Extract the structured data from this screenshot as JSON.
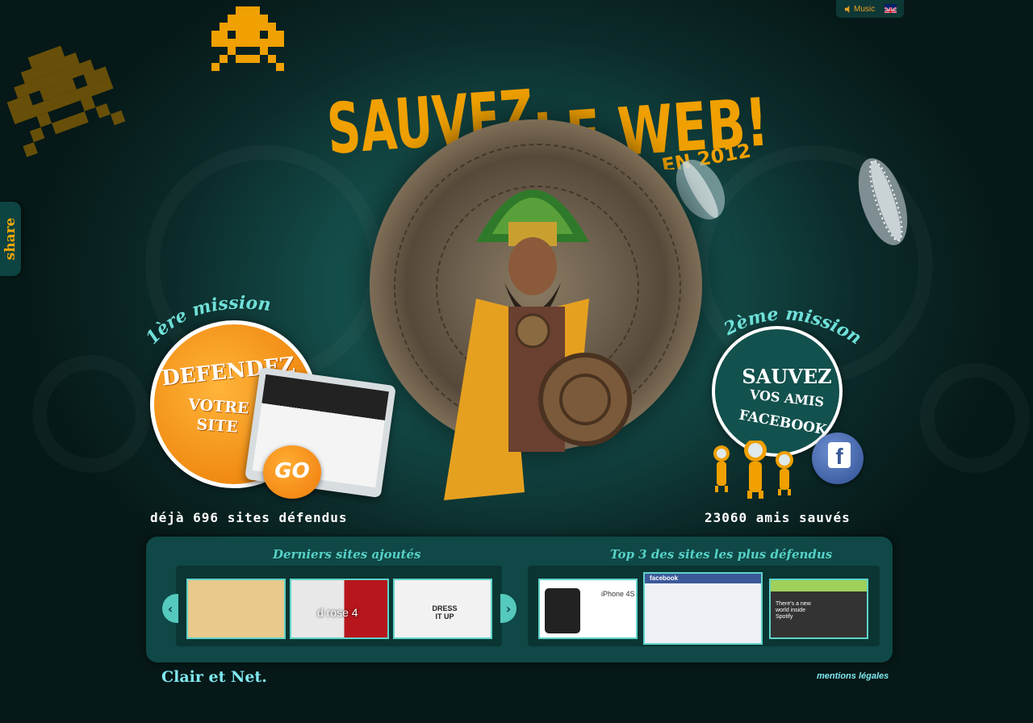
{
  "topbar": {
    "music_label": "Music",
    "language_flag": "uk-flag-icon"
  },
  "share": {
    "label": "share"
  },
  "header": {
    "title_line1": "SAUVEZ",
    "title_line2": "LE WEB!",
    "year": "EN 2012"
  },
  "mission1": {
    "label": "1ère mission",
    "title": "DEFENDEZ",
    "subtitle_line1": "VOTRE",
    "subtitle_line2": "SITE",
    "go_label": "GO",
    "stat": "déjà 696 sites défendus"
  },
  "mission2": {
    "label": "2ème mission",
    "title": "SAUVEZ",
    "line2": "VOS AMIS",
    "line3": "FACEBOOK",
    "facebook_icon": "f",
    "stat": "23060 amis sauvés"
  },
  "latest": {
    "title": "Derniers sites ajoutés",
    "thumbs": [
      {
        "caption": ""
      },
      {
        "caption": "d rose 4"
      },
      {
        "caption": "DRESS IT UP"
      }
    ]
  },
  "top3": {
    "title": "Top 3 des sites les plus défendus",
    "thumbs": [
      {
        "caption": "iPhone 4S"
      },
      {
        "caption": "facebook"
      },
      {
        "caption": "There's a new world inside Spotify"
      }
    ]
  },
  "footer": {
    "brand": "Clair et Net.",
    "legal": "mentions légales"
  },
  "colors": {
    "accent_orange": "#f0a800",
    "teal": "#56d1c7",
    "panel": "#0f4846"
  }
}
